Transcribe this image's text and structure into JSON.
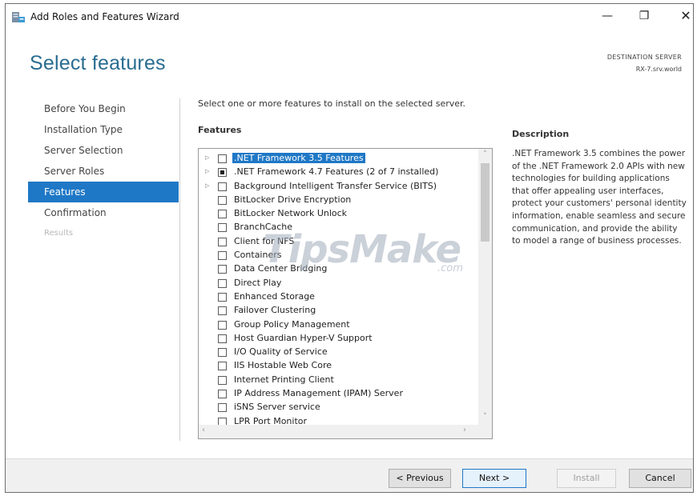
{
  "window": {
    "title": "Add Roles and Features Wizard",
    "minimize_glyph": "—",
    "maximize_glyph": "❐",
    "close_glyph": "✕"
  },
  "header": {
    "page_title": "Select features",
    "destination_label": "DESTINATION SERVER",
    "destination_value": "RX-7.srv.world"
  },
  "nav": {
    "items": [
      {
        "label": "Before You Begin",
        "state": "normal"
      },
      {
        "label": "Installation Type",
        "state": "normal"
      },
      {
        "label": "Server Selection",
        "state": "normal"
      },
      {
        "label": "Server Roles",
        "state": "normal"
      },
      {
        "label": "Features",
        "state": "active"
      },
      {
        "label": "Confirmation",
        "state": "normal"
      },
      {
        "label": "Results",
        "state": "disabled"
      }
    ]
  },
  "main": {
    "instruction": "Select one or more features to install on the selected server.",
    "features_heading": "Features",
    "features": [
      {
        "label": ".NET Framework 3.5 Features",
        "expandable": true,
        "check": "unchecked",
        "selected": true
      },
      {
        "label": ".NET Framework 4.7 Features (2 of 7 installed)",
        "expandable": true,
        "check": "partial",
        "selected": false
      },
      {
        "label": "Background Intelligent Transfer Service (BITS)",
        "expandable": true,
        "check": "unchecked",
        "selected": false
      },
      {
        "label": "BitLocker Drive Encryption",
        "expandable": false,
        "check": "unchecked",
        "selected": false
      },
      {
        "label": "BitLocker Network Unlock",
        "expandable": false,
        "check": "unchecked",
        "selected": false
      },
      {
        "label": "BranchCache",
        "expandable": false,
        "check": "unchecked",
        "selected": false
      },
      {
        "label": "Client for NFS",
        "expandable": false,
        "check": "unchecked",
        "selected": false
      },
      {
        "label": "Containers",
        "expandable": false,
        "check": "unchecked",
        "selected": false
      },
      {
        "label": "Data Center Bridging",
        "expandable": false,
        "check": "unchecked",
        "selected": false
      },
      {
        "label": "Direct Play",
        "expandable": false,
        "check": "unchecked",
        "selected": false
      },
      {
        "label": "Enhanced Storage",
        "expandable": false,
        "check": "unchecked",
        "selected": false
      },
      {
        "label": "Failover Clustering",
        "expandable": false,
        "check": "unchecked",
        "selected": false
      },
      {
        "label": "Group Policy Management",
        "expandable": false,
        "check": "unchecked",
        "selected": false
      },
      {
        "label": "Host Guardian Hyper-V Support",
        "expandable": false,
        "check": "unchecked",
        "selected": false
      },
      {
        "label": "I/O Quality of Service",
        "expandable": false,
        "check": "unchecked",
        "selected": false
      },
      {
        "label": "IIS Hostable Web Core",
        "expandable": false,
        "check": "unchecked",
        "selected": false
      },
      {
        "label": "Internet Printing Client",
        "expandable": false,
        "check": "unchecked",
        "selected": false
      },
      {
        "label": "IP Address Management (IPAM) Server",
        "expandable": false,
        "check": "unchecked",
        "selected": false
      },
      {
        "label": "iSNS Server service",
        "expandable": false,
        "check": "unchecked",
        "selected": false
      },
      {
        "label": "LPR Port Monitor",
        "expandable": false,
        "check": "unchecked",
        "selected": false
      }
    ],
    "scroll_up_glyph": "˄",
    "scroll_down_glyph": "˅",
    "scroll_left_glyph": "‹",
    "scroll_right_glyph": "›"
  },
  "description": {
    "heading": "Description",
    "text": ".NET Framework 3.5 combines the power of the .NET Framework 2.0 APIs with new technologies for building applications that offer appealing user interfaces, protect your customers' personal identity information, enable seamless and secure communication, and provide the ability to model a range of business processes."
  },
  "watermark": {
    "main": "TipsMake",
    "suffix": ".com"
  },
  "footer": {
    "previous_label": "< Previous",
    "next_label": "Next >",
    "install_label": "Install",
    "cancel_label": "Cancel"
  },
  "colors": {
    "accent": "#1f78c6",
    "title_blue": "#2a6d91"
  }
}
